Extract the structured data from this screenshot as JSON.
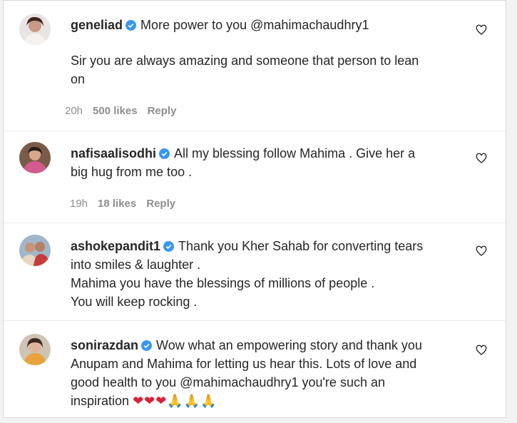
{
  "comments": [
    {
      "username": "geneliad",
      "text_line1": "More power to you @mahimachaudhry1",
      "text_line2": "Sir you are always amazing and someone that person to lean",
      "text_line3": "on",
      "time": "20h",
      "likes": "500 likes",
      "reply": "Reply"
    },
    {
      "username": "nafisaalisodhi",
      "text_line1": "All my blessing follow Mahima . Give her a",
      "text_line2": "big hug from me too .",
      "time": "19h",
      "likes": "18 likes",
      "reply": "Reply"
    },
    {
      "username": "ashokepandit1",
      "text_line1": "Thank you Kher Sahab for converting tears",
      "text_line2": "into smiles & laughter .",
      "text_line3": "Mahima you have the blessings of millions of people .",
      "text_line4": "You will keep rocking ."
    },
    {
      "username": "sonirazdan",
      "text_line1": "Wow what an empowering story and thank you",
      "text_line2": "Anupam and Mahima for letting us hear this. Lots of love and",
      "text_line3": "good health to you @mahimachaudhry1 you're such an",
      "text_line4": "inspiration",
      "emojis": "❤❤❤🙏🙏🙏"
    }
  ],
  "colors": {
    "text": "#262626",
    "secondary": "#8e8e8e",
    "verified": "#3897f0",
    "heart_emoji": "#d6233a"
  },
  "icons": [
    "verified-badge-icon",
    "heart-outline-icon"
  ]
}
